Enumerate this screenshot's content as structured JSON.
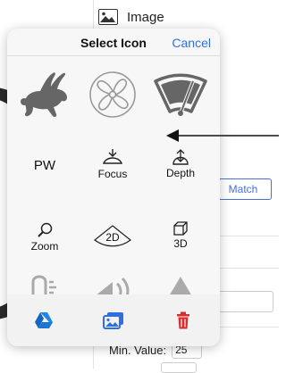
{
  "background": {
    "image_label": "Image",
    "match_button": "Match",
    "min_value_label": "Min. Value:",
    "min_value": "25"
  },
  "popover": {
    "title": "Select Icon",
    "cancel_label": "Cancel",
    "icons": [
      {
        "name": "rabbit",
        "label": ""
      },
      {
        "name": "fan",
        "label": ""
      },
      {
        "name": "wiper",
        "label": ""
      },
      {
        "name": "pw",
        "label": "PW"
      },
      {
        "name": "focus",
        "label": "Focus"
      },
      {
        "name": "depth",
        "label": "Depth"
      },
      {
        "name": "zoom",
        "label": "Zoom"
      },
      {
        "name": "2d",
        "label": "2D"
      },
      {
        "name": "3d",
        "label": "3D"
      },
      {
        "name": "probe",
        "label": ""
      },
      {
        "name": "volume",
        "label": ""
      },
      {
        "name": "triangle",
        "label": ""
      }
    ],
    "footer": {
      "drive_color": "#1a73e8",
      "photos_color": "#2f6fdf",
      "trash_color": "#d32f2f"
    }
  }
}
